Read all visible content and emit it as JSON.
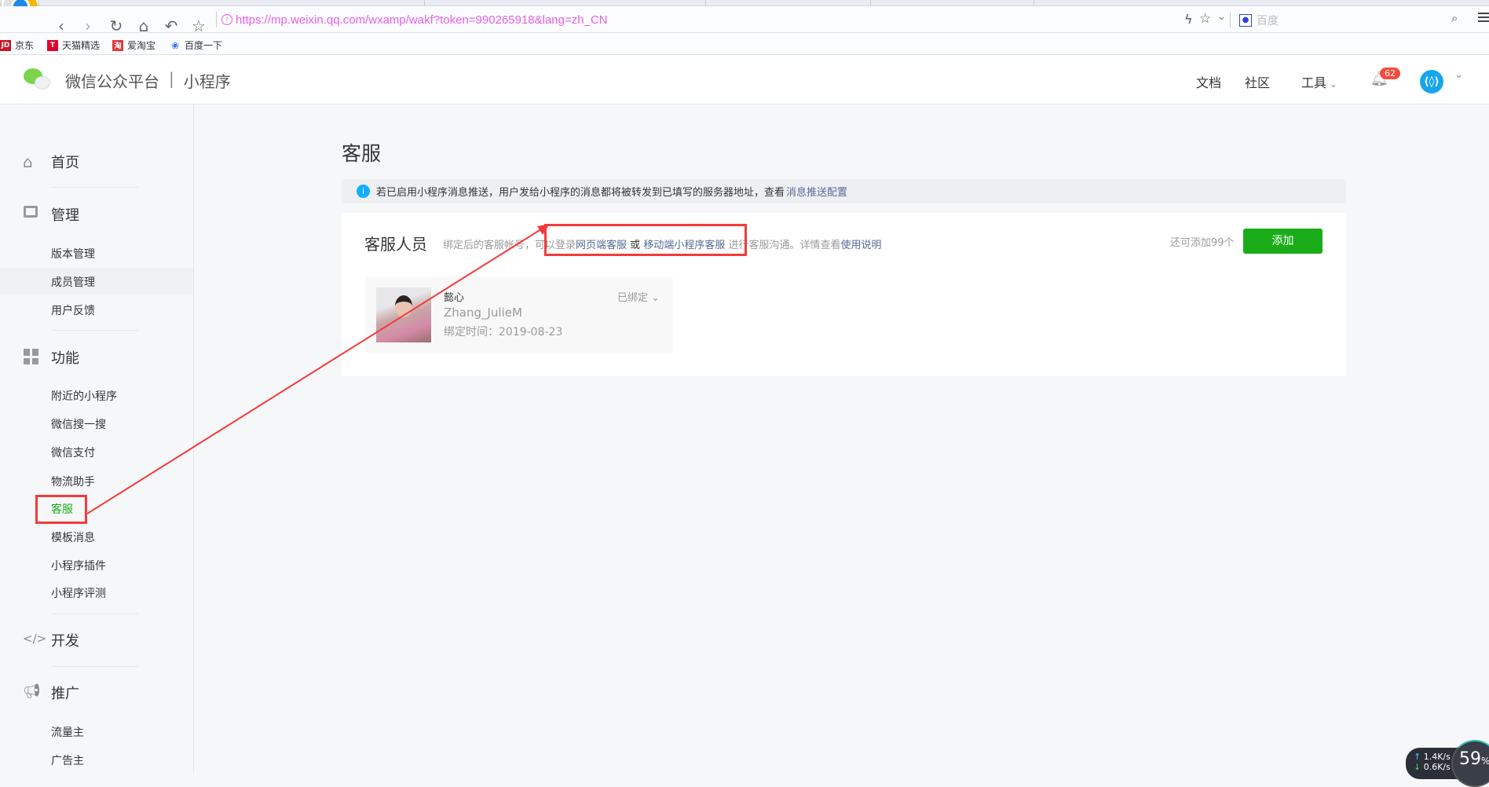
{
  "browser": {
    "url": "https://mp.weixin.qq.com/wxamp/wakf?token=990265918&lang=zh_CN",
    "search_placeholder": "百度",
    "bookmarks": [
      {
        "label": "京东",
        "icon": "JD",
        "color": "#c81623"
      },
      {
        "label": "天猫精选",
        "icon": "T",
        "color": "#e4002b"
      },
      {
        "label": "爱淘宝",
        "icon": "淘",
        "color": "#e4393c"
      },
      {
        "label": "百度一下",
        "icon": "paw",
        "color": "#2f6bff"
      }
    ]
  },
  "header": {
    "brand": "微信公众平台",
    "separator": "|",
    "product": "小程序",
    "nav": [
      "文档",
      "社区",
      "工具"
    ],
    "notification_count": "62"
  },
  "sidebar": {
    "home": "首页",
    "manage": {
      "label": "管理",
      "items": [
        "版本管理",
        "成员管理",
        "用户反馈"
      ]
    },
    "features": {
      "label": "功能",
      "items": [
        "附近的小程序",
        "微信搜一搜",
        "微信支付",
        "物流助手",
        "客服",
        "模板消息",
        "小程序插件",
        "小程序评测"
      ]
    },
    "develop": "开发",
    "promote": {
      "label": "推广",
      "items": [
        "流量主",
        "广告主"
      ]
    }
  },
  "main": {
    "title": "客服",
    "notice": {
      "text": "若已启用小程序消息推送，用户发给小程序的消息都将被转发到已填写的服务器地址，查看",
      "link": "消息推送配置"
    },
    "staff": {
      "title": "客服人员",
      "desc_1": "绑定后的客服帐号，可以登录",
      "link_web": "网页端客服",
      "or": "或",
      "link_mobile": "移动端小程序客服",
      "desc_2": "进行客服沟通。详情查看",
      "link_help": "使用说明",
      "remaining": "还可添加99个",
      "add_button": "添加",
      "members": [
        {
          "nickname": "懿心",
          "account": "Zhang_JulieM",
          "bind_time": "绑定时间：2019-08-23",
          "status": "已绑定"
        }
      ]
    }
  },
  "widget": {
    "up": "1.4K/s",
    "down": "0.6K/s",
    "percent": "59",
    "percent_sign": "%"
  },
  "colors": {
    "accent": "#1aad19",
    "link": "#576b95",
    "annotation": "#f33b3b"
  }
}
